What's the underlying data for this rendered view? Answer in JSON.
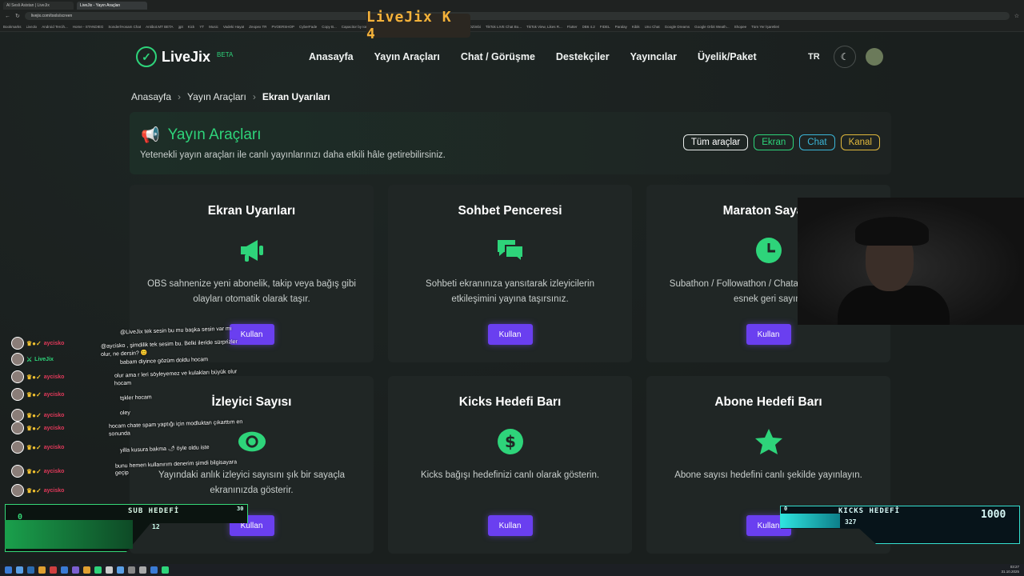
{
  "browser": {
    "tabs": [
      "AI Sesli Asistan | LiveJix",
      "LiveJix - Yayın Araçları"
    ],
    "url": "livejix.com/tools/screen",
    "bookmarks": [
      "Bookmarks",
      "LiveJix",
      "Android Tercih...",
      "Home - STANDIEG",
      "Sonder/Hosam Chat",
      "Antibot.MT BETA",
      "gpt",
      "Kick",
      "YT",
      "Music",
      "Vadeki Hayat",
      "Zeopex TR",
      "PVOERSHOP",
      "CyberFade",
      "Copy B...",
      "Capacitor by Ionic",
      "Claimed. Bottled",
      "Squarespace Domai...",
      "Sesbin Ablasi DZimbi",
      "TikTok LIVE Chat Bo...",
      "TikTok View, Likes R...",
      "Flutter",
      "DB6 4.2",
      "FIDEL",
      "Paralay",
      "Kibik",
      "Uno Chat",
      "Google Dreams",
      "Google Orbit Weath...",
      "Shopee",
      "Tüm Yer İşaretleri"
    ]
  },
  "overlay_logo": "LiveJix K 4",
  "nav": {
    "logo_check": "✓",
    "brand": "LiveJix",
    "beta": "BETA",
    "items": [
      "Anasayfa",
      "Yayın Araçları",
      "Chat / Görüşme",
      "Destekçiler",
      "Yayıncılar",
      "Üyelik/Paket"
    ],
    "lang": "TR",
    "theme_icon": "☾"
  },
  "breadcrumb": {
    "items": [
      "Anasayfa",
      "Yayın Araçları",
      "Ekran Uyarıları"
    ],
    "sep": "›"
  },
  "hero": {
    "icon": "📢",
    "title": "Yayın Araçları",
    "subtitle": "Yetenekli yayın araçları ile canlı yayınlarınızı daha etkili hâle getirebilirsiniz.",
    "filters": [
      "Tüm araçlar",
      "Ekran",
      "Chat",
      "Kanal"
    ]
  },
  "cards": [
    {
      "title": "Ekran Uyarıları",
      "icon": "megaphone-icon",
      "desc": "OBS sahnenize yeni abonelik, takip veya bağış gibi olayları otomatik olarak taşır.",
      "btn": "Kullan"
    },
    {
      "title": "Sohbet Penceresi",
      "icon": "chat-bubbles-icon",
      "desc": "Sohbeti ekranınıza yansıtarak izleyicilerin etkileşimini yayına taşırsınız.",
      "btn": "Kullan"
    },
    {
      "title": "Maraton Sayacı",
      "icon": "clock-icon",
      "desc": "Subathon / Followathon / Chatathon yayınlar için esnek geri sayım",
      "btn": "Kullan"
    },
    {
      "title": "İzleyici Sayısı",
      "icon": "eye-icon",
      "desc": "Yayındaki anlık izleyici sayısını şık bir sayaçla ekranınızda gösterir.",
      "btn": "Kullan"
    },
    {
      "title": "Kicks Hedefi Barı",
      "icon": "dollar-icon",
      "desc": "Kicks bağışı hedefinizi canlı olarak gösterin.",
      "btn": "Kullan"
    },
    {
      "title": "Abone Hedefi Barı",
      "icon": "star-icon",
      "desc": "Abone sayısı hedefini canlı şekilde yayınlayın.",
      "btn": "Kullan"
    }
  ],
  "stream_chat": {
    "users": [
      "aycisko",
      "LiveJix",
      "aycisko",
      "aycisko",
      "aycisko",
      "aycisko",
      "aycisko",
      "aycisko",
      "aycisko"
    ],
    "messages": [
      "@LiveJix tek sesin bu mu başka sesin var mı",
      "@aycisko , şimdilik tek sesim bu. Belki ileride sürprizler",
      "olur, ne dersin? 😊",
      "babam diyince gözüm doldu hocam",
      "olur ama r leri söyleyemez ve kulakları büyük olur",
      "hocam",
      "tşkler hocam",
      "oley",
      "hocam chate spam yaptığı için modluktan çıkarttım en",
      "sonunda",
      "yilla kusura bakma 🌶 öyle oldu iste",
      "bunu hemen kullanırım denerim şimdi bilgisayara",
      "geçip"
    ]
  },
  "sub_goal": {
    "title": "SUB HEDEFİ",
    "current": "0",
    "value": "12",
    "target": "30",
    "fill": 0.4
  },
  "kicks_goal": {
    "title": "KICKS HEDEFİ",
    "current": "0",
    "value": "327",
    "target": "1000",
    "fill": 0.33
  },
  "clock": {
    "time": "03:27",
    "date": "31.10.2025"
  }
}
